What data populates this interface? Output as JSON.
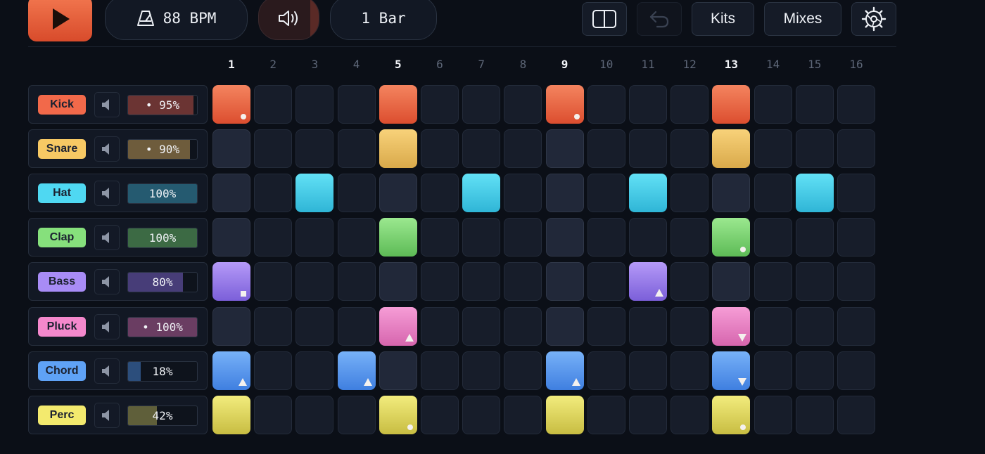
{
  "toolbar": {
    "play_icon": "play-icon",
    "bpm_label": "88 BPM",
    "metronome_icon": "metronome-icon",
    "volume_icon": "speaker-icon",
    "bars_label": "1 Bar",
    "panel_icon": "split-panel-icon",
    "undo_icon": "undo-icon",
    "kits_label": "Kits",
    "mixes_label": "Mixes",
    "settings_icon": "gear-icon",
    "accent": "#e4553a"
  },
  "step_numbers": [
    "1",
    "2",
    "3",
    "4",
    "5",
    "6",
    "7",
    "8",
    "9",
    "10",
    "11",
    "12",
    "13",
    "14",
    "15",
    "16"
  ],
  "beat_steps": [
    1,
    5,
    9,
    13
  ],
  "tracks": [
    {
      "name": "Kick",
      "color": "#f2694a",
      "top": "#f4845f",
      "bottom": "#dc4e2f",
      "volume_label": "• 95%",
      "level": 0.95,
      "fill": "#6b3433",
      "steps": {
        "1": "dot",
        "5": "",
        "9": "dot",
        "13": ""
      }
    },
    {
      "name": "Snare",
      "color": "#f7c964",
      "top": "#f8d27a",
      "bottom": "#d9a94a",
      "volume_label": "• 90%",
      "level": 0.9,
      "fill": "#6e5c3c",
      "steps": {
        "5": "",
        "13": ""
      }
    },
    {
      "name": "Hat",
      "color": "#4fd8f2",
      "top": "#62e1f6",
      "bottom": "#2fb5d6",
      "volume_label": "100%",
      "level": 1.0,
      "fill": "#255a70",
      "steps": {
        "3": "",
        "7": "",
        "11": "",
        "15": ""
      }
    },
    {
      "name": "Clap",
      "color": "#86e07c",
      "top": "#9be88f",
      "bottom": "#5dbb56",
      "volume_label": "100%",
      "level": 1.0,
      "fill": "#3c6a44",
      "steps": {
        "5": "",
        "13": "dot"
      }
    },
    {
      "name": "Bass",
      "color": "#a88cf6",
      "top": "#b59af8",
      "bottom": "#7b5fd9",
      "volume_label": "80%",
      "level": 0.8,
      "fill": "#473d78",
      "steps": {
        "1": "square",
        "11": "up"
      }
    },
    {
      "name": "Pluck",
      "color": "#f488cc",
      "top": "#f69dd6",
      "bottom": "#d666ae",
      "volume_label": "• 100%",
      "level": 1.0,
      "fill": "#6a3d62",
      "steps": {
        "5": "up",
        "13": "down"
      }
    },
    {
      "name": "Chord",
      "color": "#5fa2f6",
      "top": "#77b1f8",
      "bottom": "#3f7fe0",
      "volume_label": "18%",
      "level": 0.18,
      "fill": "#2c4e7c",
      "steps": {
        "1": "up",
        "4": "up",
        "9": "up",
        "13": "down"
      }
    },
    {
      "name": "Perc",
      "color": "#f3ea6e",
      "top": "#f2ec7d",
      "bottom": "#c8bd42",
      "volume_label": "42%",
      "level": 0.42,
      "fill": "#5f5f3a",
      "steps": {
        "1": "",
        "5": "dot",
        "9": "",
        "13": "dot"
      }
    }
  ],
  "mute_icon": "speaker-mute-icon"
}
